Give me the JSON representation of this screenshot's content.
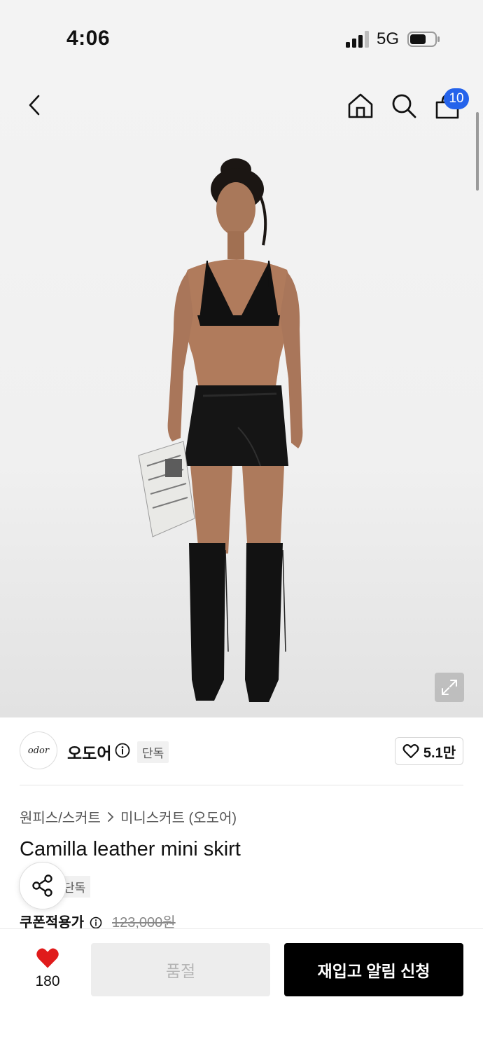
{
  "status": {
    "time": "4:06",
    "network": "5G"
  },
  "header": {
    "cart_count": "10"
  },
  "brand": {
    "logo_text": "odor",
    "name": "오도어",
    "exclusive_badge": "단독",
    "likes": "5.1만"
  },
  "breadcrumb": {
    "category": "원피스/스커트",
    "subcategory": "미니스커트 (오도어)"
  },
  "product": {
    "title": "Camilla leather mini skirt",
    "exclusive_badge": "단독"
  },
  "price": {
    "label": "쿠폰적용가",
    "original": "123,000원"
  },
  "bottom": {
    "wish_count": "180",
    "soldout_label": "품절",
    "restock_label": "재입고 알림 신청"
  }
}
